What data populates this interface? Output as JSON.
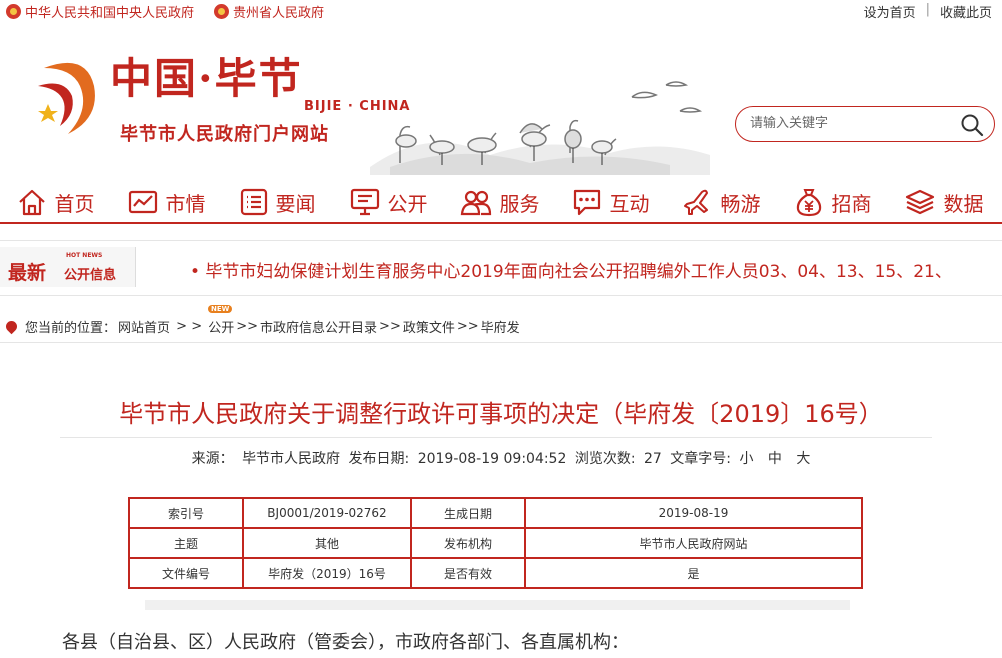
{
  "topbar": {
    "link_central": "中华人民共和国中央人民政府",
    "link_province": "贵州省人民政府",
    "set_home": "设为首页",
    "favorite": "收藏此页",
    "separator": "|"
  },
  "header": {
    "logo_cn": "中国·毕节",
    "logo_en": "BIJIE · CHINA",
    "site_name": "毕节市人民政府门户网站",
    "search_placeholder": "请输入关键字",
    "accent_color": "#c1261f"
  },
  "nav": {
    "items": [
      {
        "label": "首页",
        "icon": "home-icon"
      },
      {
        "label": "市情",
        "icon": "chart-icon"
      },
      {
        "label": "要闻",
        "icon": "list-icon"
      },
      {
        "label": "公开",
        "icon": "monitor-icon"
      },
      {
        "label": "服务",
        "icon": "people-icon"
      },
      {
        "label": "互动",
        "icon": "chat-icon"
      },
      {
        "label": "畅游",
        "icon": "plane-icon"
      },
      {
        "label": "招商",
        "icon": "money-bag-icon"
      },
      {
        "label": "数据",
        "icon": "layers-icon"
      }
    ]
  },
  "ticker": {
    "badge_main": "最新",
    "badge_hot": "HOT NEWS",
    "badge_sub": "公开信息",
    "text": "• 毕节市妇幼保健计划生育服务中心2019年面向社会公开招聘编外工作人员03、04、13、15、21、"
  },
  "breadcrumb": {
    "prefix": "您当前的位置：",
    "items": [
      "网站首页",
      "公开",
      "市政府信息公开目录",
      "政策文件",
      "毕府发"
    ],
    "sep_first": " > > ",
    "sep": ">>",
    "new_tag": "NEW"
  },
  "article": {
    "title": "毕节市人民政府关于调整行政许可事项的决定（毕府发〔2019〕16号）",
    "meta": {
      "source_label": "来源：",
      "source": "毕节市人民政府",
      "date_label": "发布日期:",
      "date": "2019-08-19 09:04:52",
      "views_label": "浏览次数:",
      "views": "27",
      "font_label": "文章字号:",
      "font_small": "小",
      "font_medium": "中",
      "font_large": "大"
    },
    "info_table": [
      [
        "索引号",
        "BJ0001/2019-02762",
        "生成日期",
        "2019-08-19"
      ],
      [
        "主题",
        "其他",
        "发布机构",
        "毕节市人民政府网站"
      ],
      [
        "文件编号",
        "毕府发（2019）16号",
        "是否有效",
        "是"
      ]
    ],
    "first_paragraph": "各县（自治县、区）人民政府（管委会），市政府各部门、各直属机构："
  }
}
